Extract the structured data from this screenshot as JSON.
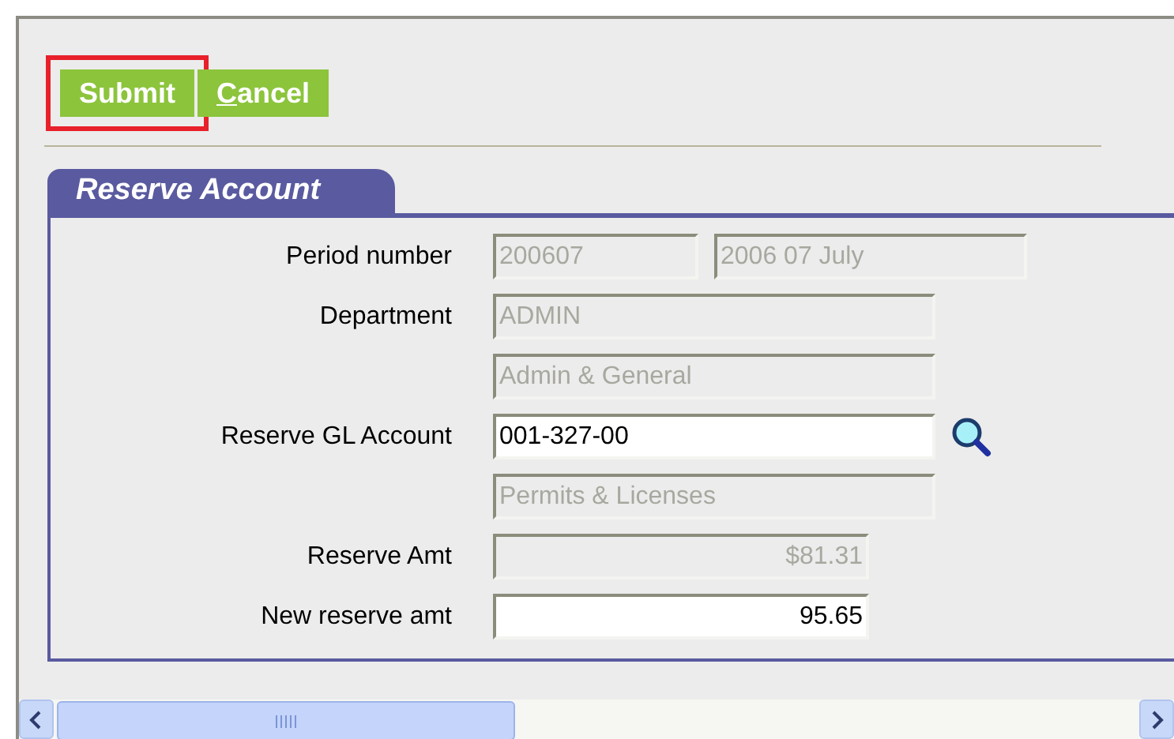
{
  "buttons": [
    {
      "label": "Submit",
      "highlighted": true,
      "first_letter_underlined": false
    },
    {
      "label": "Cancel",
      "highlighted": false,
      "first_letter_underlined": true
    }
  ],
  "section": {
    "title": "Reserve Account"
  },
  "rows": [
    {
      "label": "Period number",
      "fields": [
        {
          "value": "200607",
          "disabled": true,
          "kind": "text"
        },
        {
          "value": "2006 07 July",
          "disabled": true,
          "kind": "text"
        }
      ],
      "lookup": false
    },
    {
      "label": "Department",
      "fields": [
        {
          "value": "ADMIN",
          "disabled": true,
          "kind": "text"
        }
      ],
      "lookup": false
    },
    {
      "fields": [
        {
          "value": "Admin & General",
          "disabled": true,
          "kind": "text"
        }
      ],
      "lookup": false
    },
    {
      "label": "Reserve GL Account",
      "fields": [
        {
          "value": "001-327-00",
          "disabled": false,
          "kind": "text"
        }
      ],
      "lookup": true
    },
    {
      "fields": [
        {
          "value": "Permits & Licenses",
          "disabled": true,
          "kind": "text"
        }
      ],
      "lookup": false
    },
    {
      "label": "Reserve Amt",
      "fields": [
        {
          "value": "$81.31",
          "disabled": true,
          "kind": "amount"
        }
      ],
      "lookup": false
    },
    {
      "label": "New reserve amt",
      "fields": [
        {
          "value": "95.65",
          "disabled": false,
          "kind": "amount"
        }
      ],
      "lookup": false
    }
  ]
}
